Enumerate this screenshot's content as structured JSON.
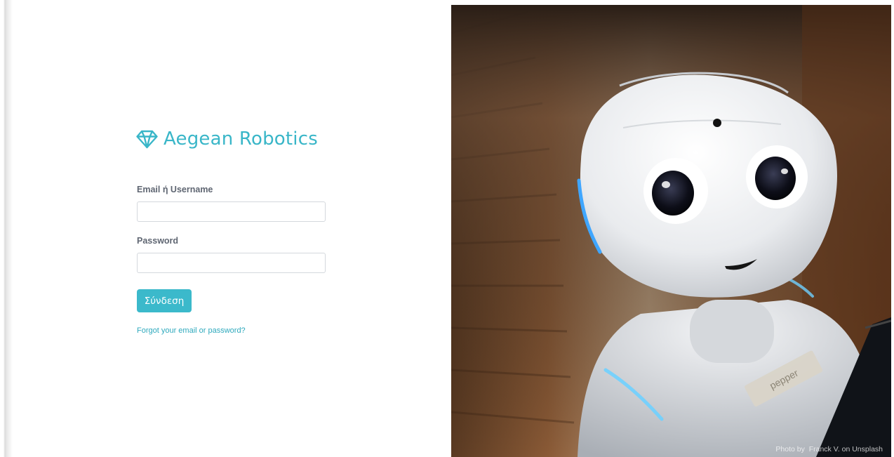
{
  "brand": {
    "icon": "diamond-icon",
    "name": "Aegean Robotics",
    "color": "#39b6c8"
  },
  "form": {
    "email_label": "Email ή Username",
    "email_value": "",
    "password_label": "Password",
    "password_value": "",
    "submit_label": "Σύνδεση",
    "forgot_link": "Forgot your email or password?"
  },
  "photo": {
    "subject": "robot",
    "credit_prefix": "Photo by",
    "credit_author": "Franck V.",
    "credit_on": "on",
    "credit_site": "Unsplash",
    "badge_text": "pepper"
  }
}
